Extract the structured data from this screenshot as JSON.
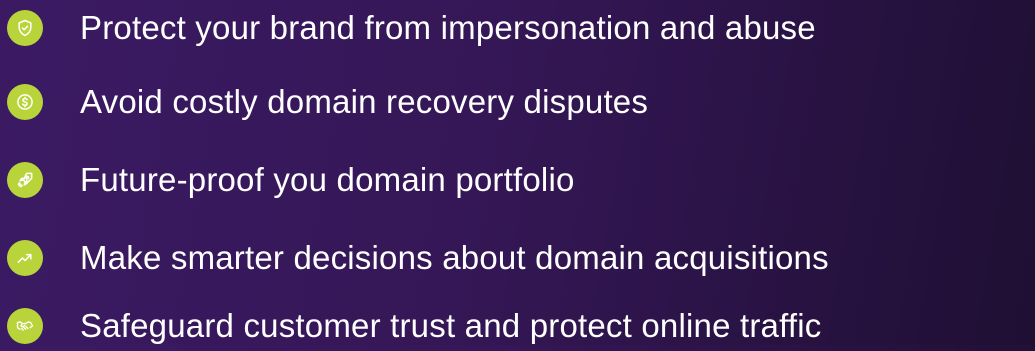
{
  "accent_color": "#b8d43a",
  "text_color": "#ffffff",
  "benefits": [
    {
      "icon": "shield-check-icon",
      "text": "Protect your brand from impersonation and abuse"
    },
    {
      "icon": "dollar-coin-icon",
      "text": "Avoid costly domain recovery disputes"
    },
    {
      "icon": "rocket-icon",
      "text": "Future-proof you domain portfolio"
    },
    {
      "icon": "trending-up-icon",
      "text": "Make smarter decisions about domain acquisitions"
    },
    {
      "icon": "handshake-icon",
      "text": "Safeguard customer trust and protect online traffic"
    }
  ]
}
